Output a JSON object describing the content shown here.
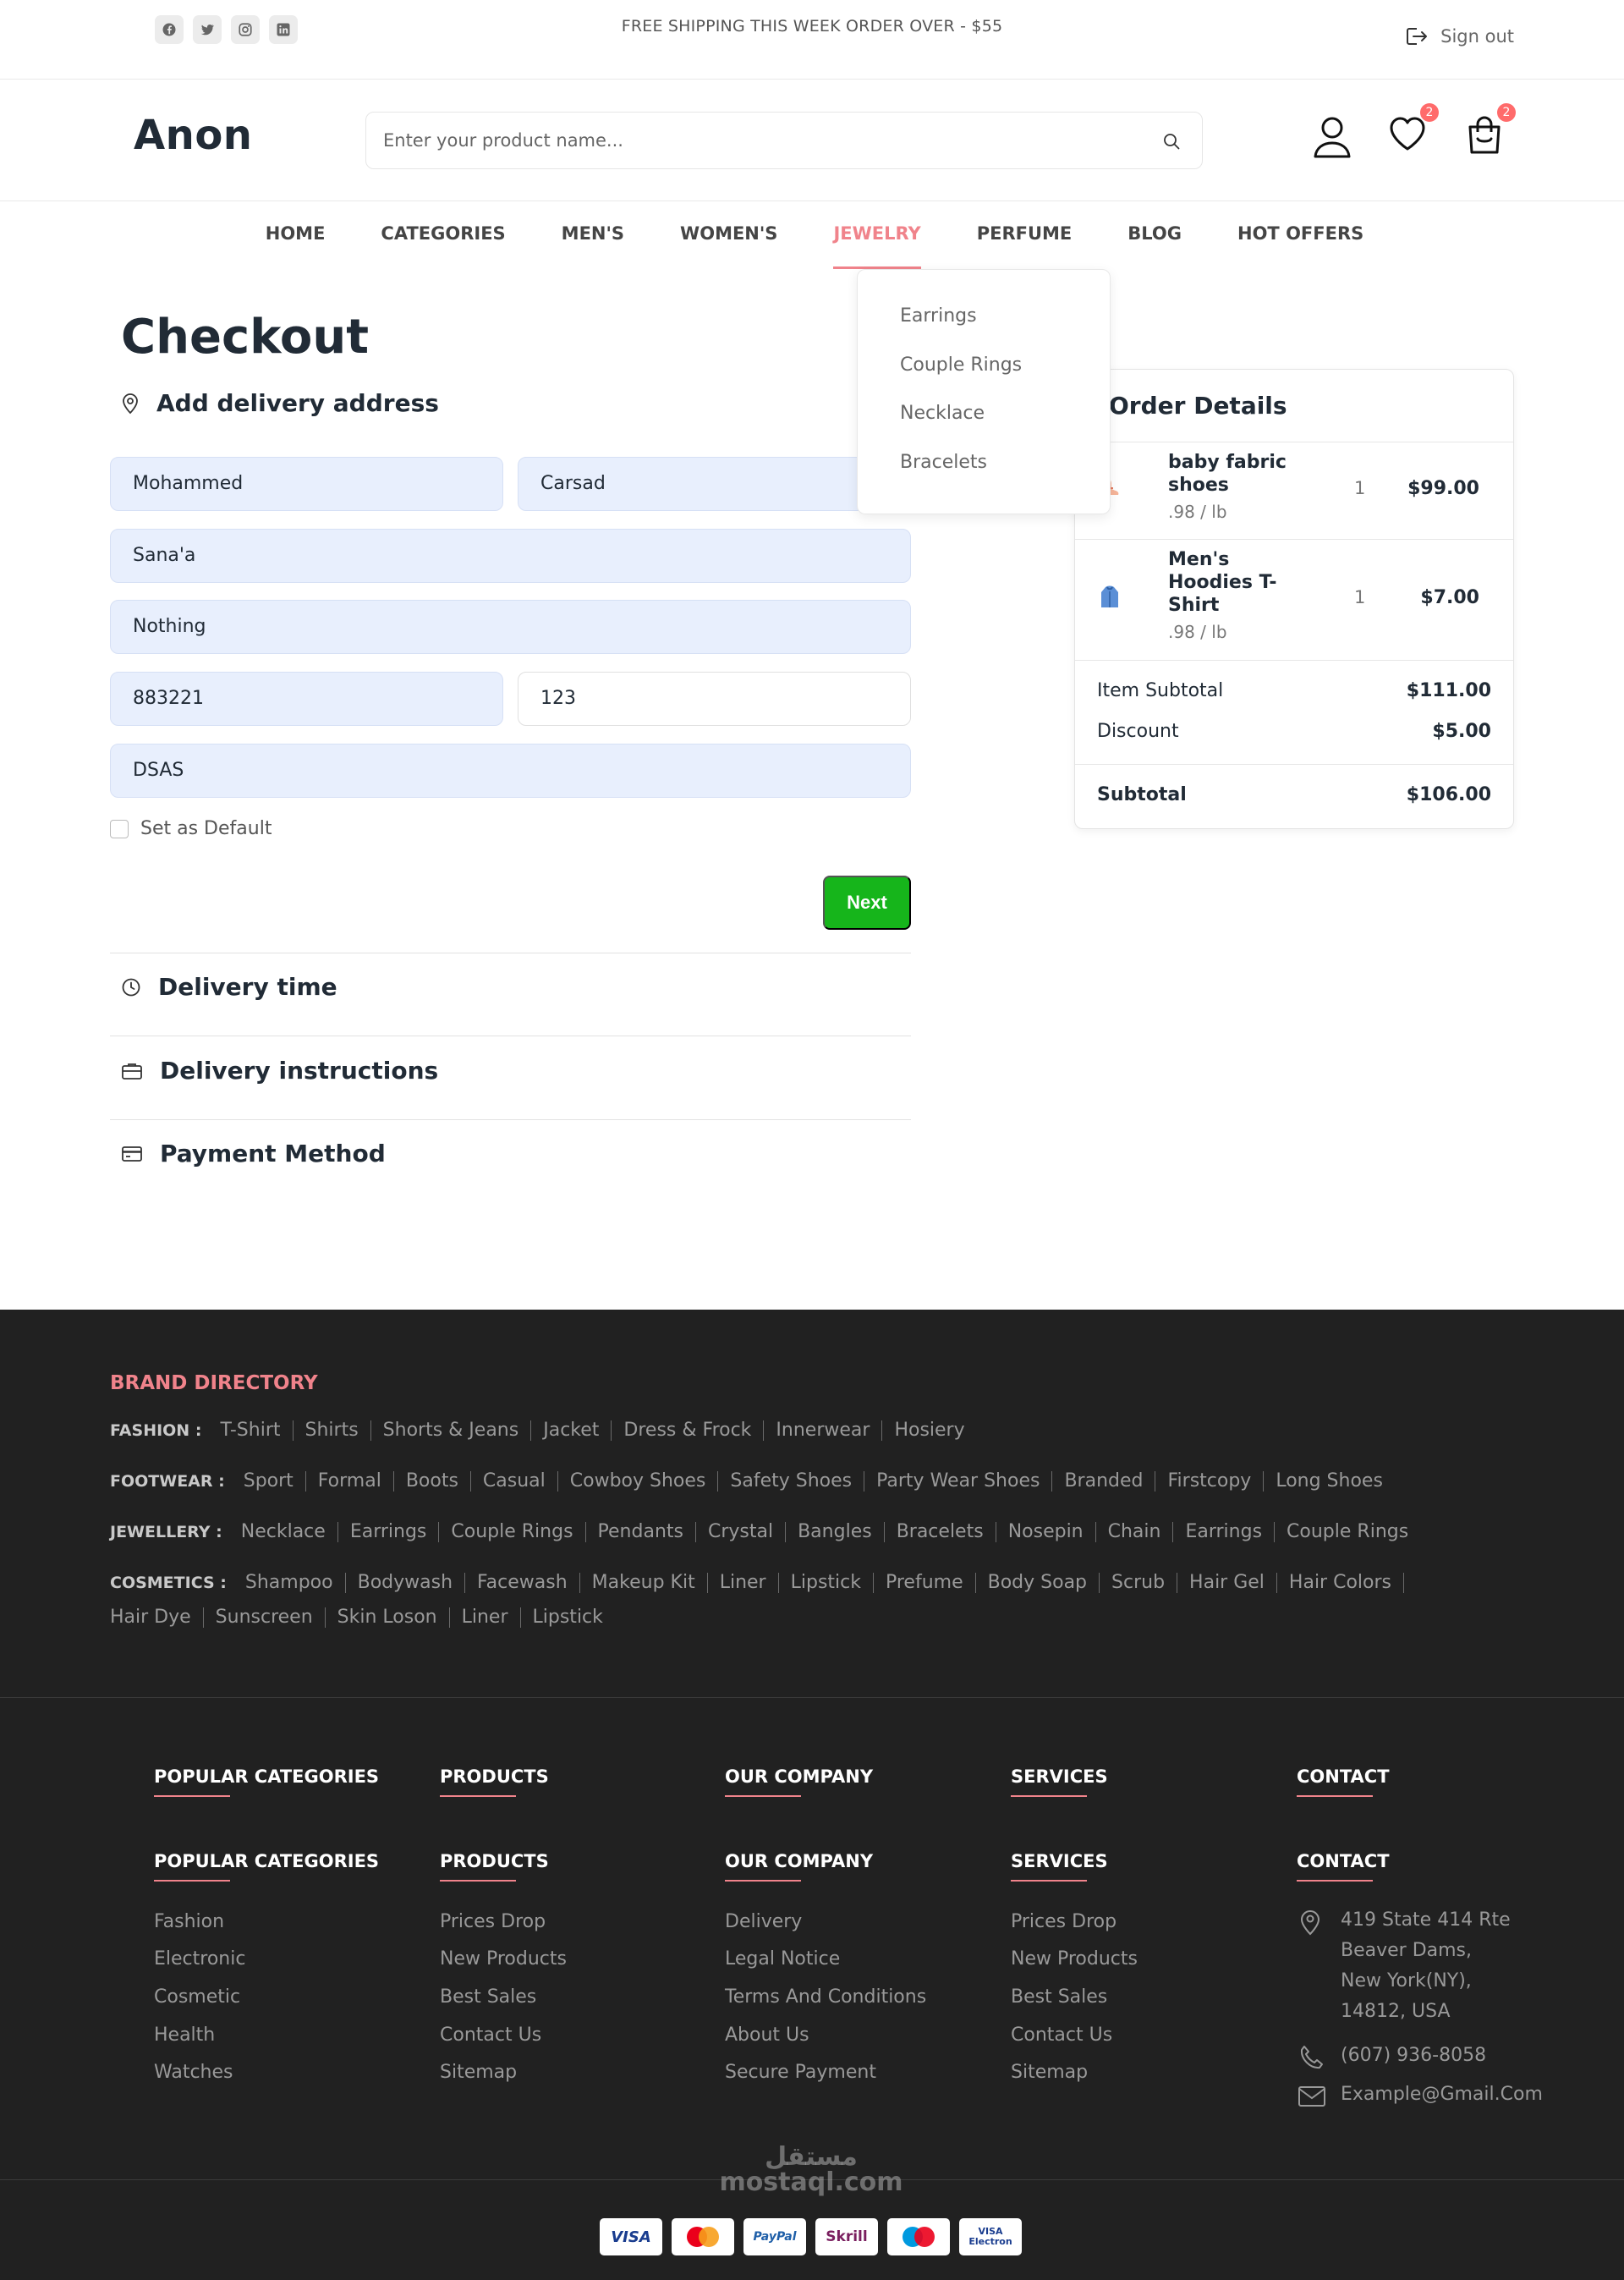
{
  "topbar": {
    "social_icons": [
      "facebook-icon",
      "twitter-icon",
      "instagram-icon",
      "linkedin-icon"
    ],
    "announcement": "FREE SHIPPING THIS WEEK ORDER OVER - $55",
    "signout_label": "Sign out"
  },
  "header": {
    "logo": "Anon",
    "search_placeholder": "Enter your product name...",
    "wishlist_count": "2",
    "cart_count": "2"
  },
  "nav": {
    "items": [
      "HOME",
      "CATEGORIES",
      "MEN'S",
      "WOMEN'S",
      "JEWELRY",
      "PERFUME",
      "BLOG",
      "HOT OFFERS"
    ],
    "active_index": 4,
    "dropdown": [
      "Earrings",
      "Couple Rings",
      "Necklace",
      "Bracelets"
    ]
  },
  "checkout": {
    "title": "Checkout",
    "address_heading": "Add delivery address",
    "fields": {
      "first_name": "Mohammed",
      "last_name": "Carsad",
      "city": "Sana'a",
      "address": "Nothing",
      "zip": "883221",
      "building": "123",
      "extra": "DSAS"
    },
    "default_label": "Set as Default",
    "next_label": "Next",
    "delivery_time": "Delivery time",
    "delivery_instructions": "Delivery instructions",
    "payment_method": "Payment Method"
  },
  "order": {
    "heading": "Order Details",
    "items": [
      {
        "name": "baby fabric shoes",
        "weight": ".98 / lb",
        "qty": "1",
        "price": "$99.00"
      },
      {
        "name": "Men's Hoodies T-Shirt",
        "weight": ".98 / lb",
        "qty": "1",
        "price": "$7.00"
      }
    ],
    "subtotal_label": "Item Subtotal",
    "subtotal_value": "$111.00",
    "discount_label": "Discount",
    "discount_value": "$5.00",
    "total_label": "Subtotal",
    "total_value": "$106.00"
  },
  "brand_directory": {
    "title": "BRAND DIRECTORY",
    "rows": [
      {
        "label": "FASHION :",
        "items": [
          "T-Shirt",
          "Shirts",
          "Shorts & Jeans",
          "Jacket",
          "Dress & Frock",
          "Innerwear",
          "Hosiery"
        ]
      },
      {
        "label": "FOOTWEAR :",
        "items": [
          "Sport",
          "Formal",
          "Boots",
          "Casual",
          "Cowboy Shoes",
          "Safety Shoes",
          "Party Wear Shoes",
          "Branded",
          "Firstcopy",
          "Long Shoes"
        ]
      },
      {
        "label": "JEWELLERY :",
        "items": [
          "Necklace",
          "Earrings",
          "Couple Rings",
          "Pendants",
          "Crystal",
          "Bangles",
          "Bracelets",
          "Nosepin",
          "Chain",
          "Earrings",
          "Couple Rings"
        ]
      },
      {
        "label": "COSMETICS :",
        "items": [
          "Shampoo",
          "Bodywash",
          "Facewash",
          "Makeup Kit",
          "Liner",
          "Lipstick",
          "Prefume",
          "Body Soap",
          "Scrub",
          "Hair Gel",
          "Hair Colors"
        ]
      },
      {
        "label": "",
        "items": [
          "Hair Dye",
          "Sunscreen",
          "Skin Loson",
          "Liner",
          "Lipstick"
        ]
      }
    ]
  },
  "footer": {
    "top_headings": [
      "POPULAR CATEGORIES",
      "PRODUCTS",
      "OUR COMPANY",
      "SERVICES",
      "CONTACT"
    ],
    "columns": [
      {
        "heading": "POPULAR CATEGORIES",
        "links": [
          "Fashion",
          "Electronic",
          "Cosmetic",
          "Health",
          "Watches"
        ]
      },
      {
        "heading": "PRODUCTS",
        "links": [
          "Prices Drop",
          "New Products",
          "Best Sales",
          "Contact Us",
          "Sitemap"
        ]
      },
      {
        "heading": "OUR COMPANY",
        "links": [
          "Delivery",
          "Legal Notice",
          "Terms And Conditions",
          "About Us",
          "Secure Payment"
        ]
      },
      {
        "heading": "SERVICES",
        "links": [
          "Prices Drop",
          "New Products",
          "Best Sales",
          "Contact Us",
          "Sitemap"
        ]
      }
    ],
    "contact_heading": "CONTACT",
    "address": [
      "419 State 414 Rte",
      "Beaver Dams,",
      "New York(NY),",
      "14812, USA"
    ],
    "phone": "(607) 936-8058",
    "email": "Example@Gmail.Com",
    "payments": [
      "VISA",
      "MasterCard",
      "PayPal",
      "Skrill",
      "Maestro",
      "VISA Electron"
    ],
    "watermark": "مستقل mostaql.com"
  },
  "colors": {
    "accent": "#f0838b",
    "next_button": "#16b51b",
    "field_bg": "#e8effd",
    "footer_bg": "#212121"
  }
}
